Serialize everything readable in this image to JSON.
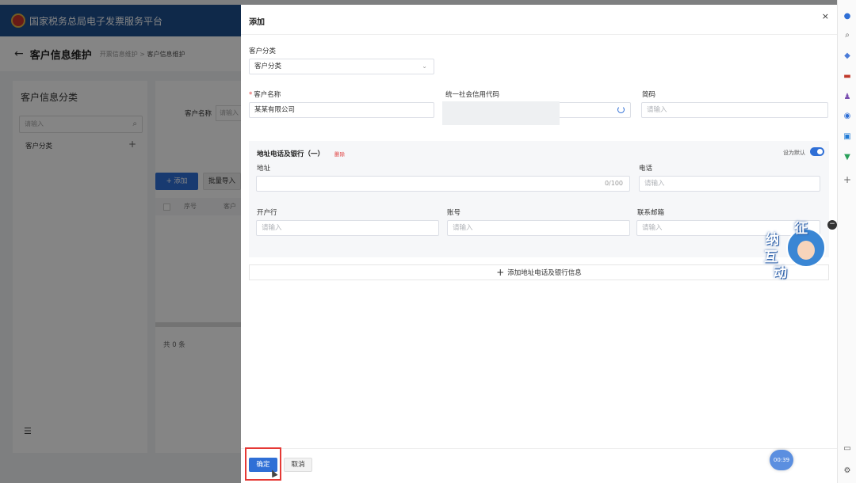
{
  "background": {
    "platform_title": "国家税务总局电子发票服务平台",
    "page_title": "客户信息维护",
    "breadcrumb": [
      "开票信息维护",
      "客户信息维护"
    ],
    "breadcrumb_sep": ">",
    "left_panel": {
      "title": "客户信息分类",
      "search_placeholder": "请输入",
      "tree_item": "客户分类"
    },
    "filter": {
      "label": "客户名称",
      "placeholder": "请输入"
    },
    "buttons": {
      "add": "+ 添加",
      "batch_import": "批量导入"
    },
    "table_headers": [
      "序号",
      "客户"
    ],
    "total": "共 0 条"
  },
  "drawer": {
    "title": "添加",
    "close": "×",
    "customer_category": {
      "label": "客户分类",
      "value": "客户分类"
    },
    "customer_name": {
      "label": "客户名称",
      "required_mark": "*",
      "value": "某某有限公司"
    },
    "credit_code": {
      "label": "统一社会信用代码",
      "value": ""
    },
    "short_code": {
      "label": "简码",
      "placeholder": "请输入"
    },
    "address_block": {
      "title": "地址电话及银行（一）",
      "delete": "删除",
      "set_default": "设为默认",
      "default_on": true,
      "address": {
        "label": "地址",
        "counter": "0/100"
      },
      "phone": {
        "label": "电话",
        "placeholder": "请输入"
      },
      "bank": {
        "label": "开户行",
        "placeholder": "请输入"
      },
      "account": {
        "label": "账号",
        "placeholder": "请输入"
      },
      "email": {
        "label": "联系邮箱",
        "placeholder": "请输入"
      }
    },
    "add_more": "添加地址电话及银行信息",
    "confirm": "确定",
    "cancel": "取消"
  },
  "mascot": {
    "chars": [
      "征",
      "纳",
      "互",
      "动"
    ]
  },
  "timer": "00:39",
  "colors": {
    "primary": "#2f6fd6",
    "header": "#1d4f8f",
    "danger": "#e03e3e",
    "highlight_box": "#e53935"
  }
}
